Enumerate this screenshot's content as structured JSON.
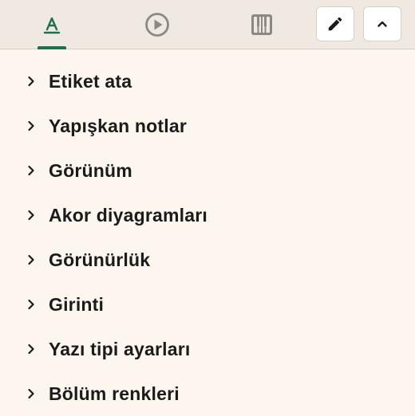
{
  "tabs": [
    {
      "icon": "text-format-icon",
      "active": true
    },
    {
      "icon": "play-circle-icon",
      "active": false
    },
    {
      "icon": "piano-icon",
      "active": false
    }
  ],
  "toolbar": {
    "edit_icon": "pencil-icon",
    "collapse_icon": "chevron-up-icon"
  },
  "colors": {
    "accent": "#1f6f4a",
    "background": "#fdf6ef",
    "topbar": "#efe9e1",
    "tab_inactive": "#8c8984"
  },
  "sections": [
    {
      "label": "Etiket ata"
    },
    {
      "label": "Yapışkan notlar"
    },
    {
      "label": "Görünüm"
    },
    {
      "label": "Akor diyagramları"
    },
    {
      "label": "Görünürlük"
    },
    {
      "label": "Girinti"
    },
    {
      "label": "Yazı tipi ayarları"
    },
    {
      "label": "Bölüm renkleri"
    }
  ]
}
